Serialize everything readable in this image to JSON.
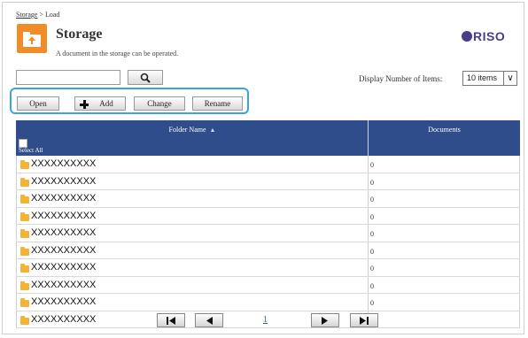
{
  "breadcrumb": {
    "link": "Storage",
    "separator": " > ",
    "current": "Load"
  },
  "header": {
    "title": "Storage",
    "subtitle": "A document in the storage can be operated.",
    "logo_text": "RISO"
  },
  "search": {
    "value": "",
    "button_icon": "search-icon"
  },
  "display": {
    "label": "Display Number of Items:",
    "selected": "10 items"
  },
  "toolbar": {
    "open": "Open",
    "add": "Add",
    "change": "Change",
    "rename": "Rename"
  },
  "table": {
    "columns": {
      "folder_name": "Folder Name",
      "documents": "Documents"
    },
    "select_all": "Select All",
    "rows": [
      {
        "name": "XXXXXXXXXX",
        "docs": "0"
      },
      {
        "name": "XXXXXXXXXX",
        "docs": "0"
      },
      {
        "name": "XXXXXXXXXX",
        "docs": "0"
      },
      {
        "name": "XXXXXXXXXX",
        "docs": "0"
      },
      {
        "name": "XXXXXXXXXX",
        "docs": "0"
      },
      {
        "name": "XXXXXXXXXX",
        "docs": "0"
      },
      {
        "name": "XXXXXXXXXX",
        "docs": "0"
      },
      {
        "name": "XXXXXXXXXX",
        "docs": "0"
      },
      {
        "name": "XXXXXXXXXX",
        "docs": "0"
      },
      {
        "name": "XXXXXXXXXX",
        "docs": "0"
      }
    ]
  },
  "pager": {
    "current_page": "1"
  },
  "colors": {
    "header_bg": "#2e4d8a",
    "accent_orange": "#f28c28",
    "highlight_border": "#3aa6dd",
    "logo": "#4a3b8c"
  }
}
